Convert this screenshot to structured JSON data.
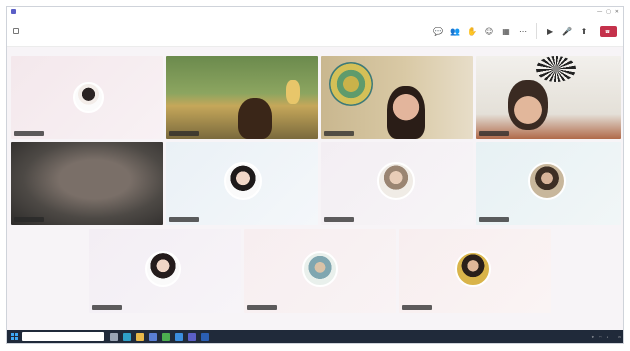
{
  "window": {
    "title": "",
    "controls": [
      "—",
      "▢",
      "✕"
    ]
  },
  "toolbar": {
    "meeting_time": "",
    "tools": [
      {
        "icon": "chat-icon",
        "glyph": "💬",
        "label": ""
      },
      {
        "icon": "people-icon",
        "glyph": "👥",
        "label": ""
      },
      {
        "icon": "raise-hand-icon",
        "glyph": "✋",
        "label": ""
      },
      {
        "icon": "reactions-icon",
        "glyph": "☺",
        "label": ""
      },
      {
        "icon": "view-icon",
        "glyph": "▦",
        "label": ""
      },
      {
        "icon": "more-icon",
        "glyph": "⋯",
        "label": ""
      }
    ],
    "media": [
      {
        "icon": "camera-icon",
        "glyph": "▶",
        "label": ""
      },
      {
        "icon": "mic-icon",
        "glyph": "🎤",
        "label": ""
      },
      {
        "icon": "share-icon",
        "glyph": "⬆",
        "label": ""
      }
    ],
    "leave_label": ""
  },
  "participants": [
    {
      "name": "",
      "kind": "avatar"
    },
    {
      "name": "",
      "kind": "video"
    },
    {
      "name": "",
      "kind": "video"
    },
    {
      "name": "",
      "kind": "video"
    },
    {
      "name": "",
      "kind": "video"
    },
    {
      "name": "",
      "kind": "avatar"
    },
    {
      "name": "",
      "kind": "avatar"
    },
    {
      "name": "",
      "kind": "avatar"
    },
    {
      "name": "",
      "kind": "avatar"
    },
    {
      "name": "",
      "kind": "avatar"
    },
    {
      "name": "",
      "kind": "avatar"
    }
  ],
  "taskbar": {
    "search_placeholder": "",
    "time": "",
    "date": ""
  },
  "colors": {
    "accent": "#5b5fc7",
    "leave": "#c4314b",
    "taskbar": "#202a3a"
  }
}
